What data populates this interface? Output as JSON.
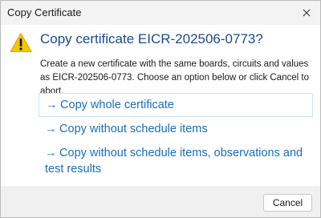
{
  "window": {
    "title": "Copy Certificate",
    "close_icon": "close-icon"
  },
  "dialog": {
    "icon": "warning-icon",
    "accent_color": "#1a4b8c",
    "heading": "Copy certificate EICR-202506-0773?",
    "description": "Create a new certificate with the same boards, circuits and values as EICR-202506-0773.  Choose an option below or click Cancel to abort.",
    "options": [
      {
        "arrow": "→",
        "label": "Copy whole certificate"
      },
      {
        "arrow": "→",
        "label": "Copy without schedule items"
      },
      {
        "arrow": "→",
        "label": "Copy without schedule items, observations and test results"
      }
    ],
    "cancel_label": "Cancel"
  }
}
